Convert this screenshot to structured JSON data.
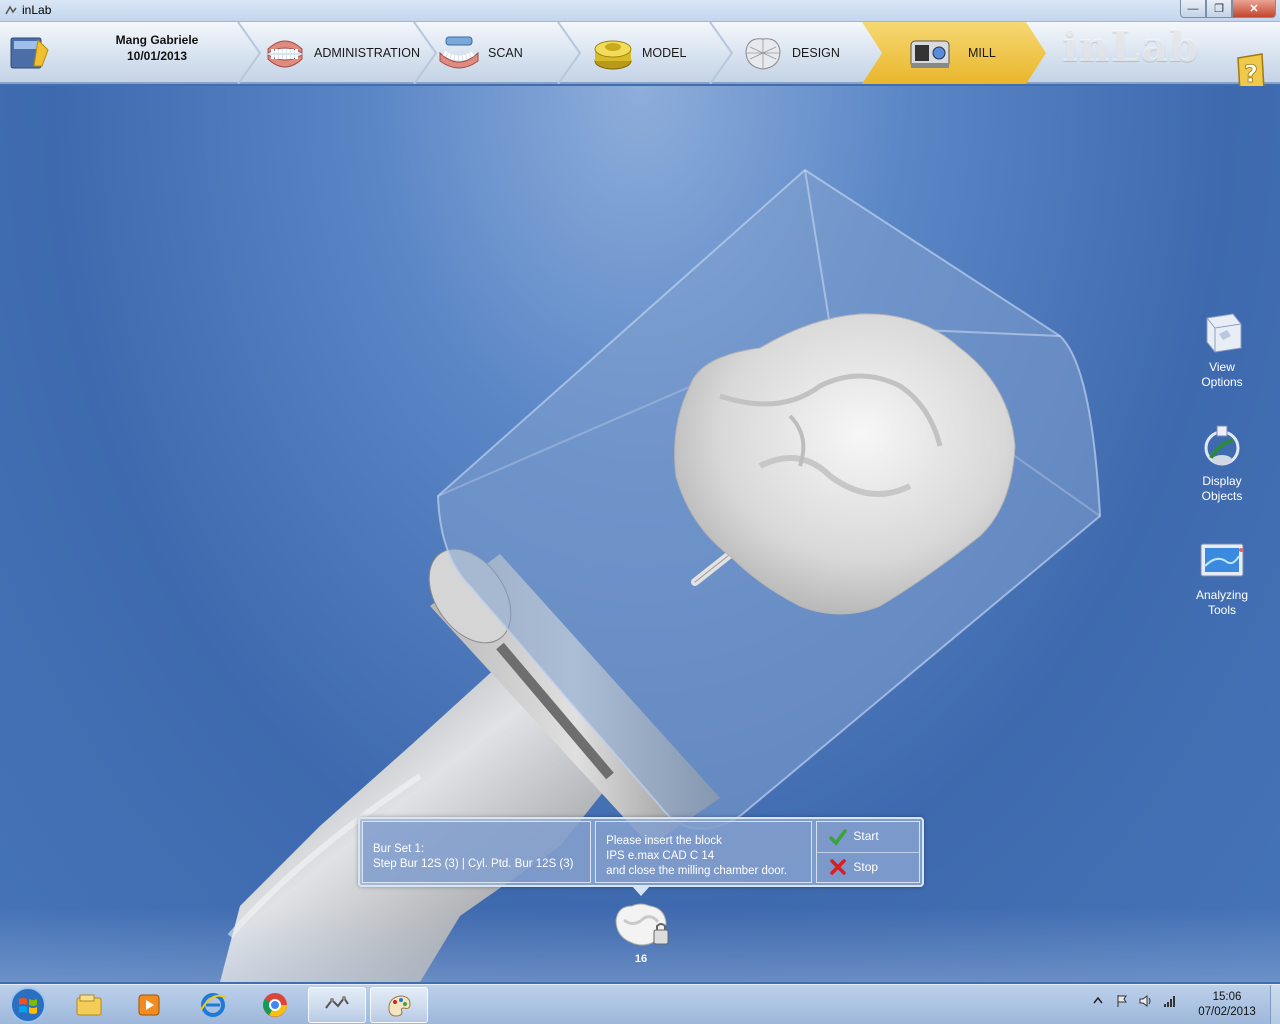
{
  "window": {
    "title": "inLab",
    "min": "—",
    "restore": "❐",
    "close": "✕"
  },
  "header": {
    "user_name": "Mang Gabriele",
    "date": "10/01/2013",
    "brand": "inLab",
    "steps": [
      {
        "label": "ADMINISTRATION",
        "icon": "dentures-icon"
      },
      {
        "label": "SCAN",
        "icon": "scan-jaw-icon"
      },
      {
        "label": "MODEL",
        "icon": "model-crown-icon"
      },
      {
        "label": "DESIGN",
        "icon": "design-mesh-icon"
      },
      {
        "label": "MILL",
        "icon": "milling-machine-icon",
        "active": true
      }
    ]
  },
  "tools": [
    {
      "label_line1": "View",
      "label_line2": "Options",
      "icon": "view-cube-icon"
    },
    {
      "label_line1": "Display",
      "label_line2": "Objects",
      "icon": "display-objects-icon"
    },
    {
      "label_line1": "Analyzing",
      "label_line2": "Tools",
      "icon": "analyzing-screen-icon"
    }
  ],
  "dialog": {
    "bur_line1": "Bur Set 1:",
    "bur_line2": "Step Bur 12S (3)  |  Cyl. Ptd. Bur 12S (3)",
    "msg_line1": "Please insert the block",
    "msg_line2": "IPS e.max CAD C 14",
    "msg_line3": "and close the milling chamber door.",
    "start_label": "Start",
    "stop_label": "Stop"
  },
  "tooth": {
    "number": "16"
  },
  "taskbar": {
    "time": "15:06",
    "date": "07/02/2013",
    "items": [
      "explorer-icon",
      "media-player-icon",
      "internet-explorer-icon",
      "chrome-icon",
      "inlab-task-icon",
      "paint-icon"
    ]
  },
  "colors": {
    "accent_active": "#e9b62b",
    "viewport": "#3e69ae",
    "start_green": "#3aa33a",
    "stop_red": "#d62020"
  }
}
